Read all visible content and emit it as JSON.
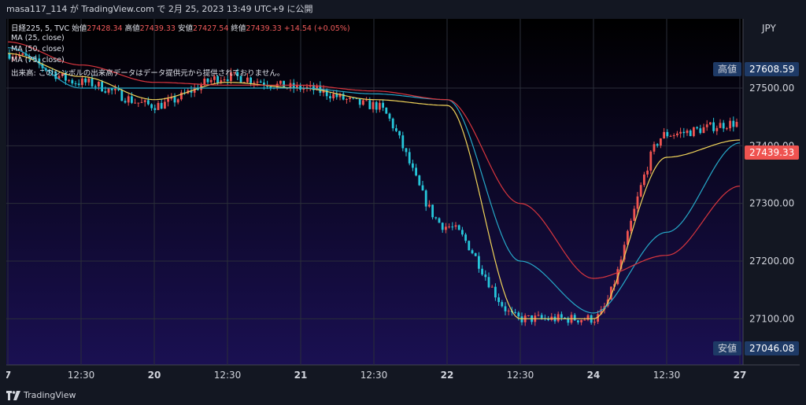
{
  "header": {
    "title": "masa117_114 が TradingView.com で 2月 25, 2023 13:49 UTC+9 に公開"
  },
  "legend": {
    "symbol": "日経225, 5, TVC",
    "open_label": "始値",
    "open_value": "27428.34",
    "high_label": "高値",
    "high_value": "27439.33",
    "low_label": "安値",
    "low_value": "27427.54",
    "close_label": "終値",
    "close_value": "27439.33",
    "change": "+14.54 (+0.05%)",
    "ma1": "MA (25, close)",
    "ma2": "MA (50, close)",
    "ma3": "MA (75, close)",
    "volume_note": "出来高: このシンボルの出来高データはデータ提供元から提供されておりません。"
  },
  "price_axis": {
    "currency": "JPY",
    "ticks": [
      "27500.00",
      "27400.00",
      "27300.00",
      "27200.00",
      "27100.00"
    ],
    "high_label": "高値",
    "high_value": "27608.59",
    "low_label": "安値",
    "low_value": "27046.08",
    "last_price": "27439.33"
  },
  "time_axis": {
    "ticks": [
      "7",
      "12:30",
      "20",
      "12:30",
      "21",
      "12:30",
      "22",
      "12:30",
      "24",
      "12:30",
      "27"
    ]
  },
  "footer": {
    "brand": "TradingView"
  },
  "colors": {
    "background_top": "#000000",
    "background_bottom": "#1a1052",
    "up": "#ef5350",
    "down": "#26c6da",
    "ma25": "#f0d35a",
    "ma50": "#26a8c8",
    "ma75": "#d9363e",
    "last_price_tag": "#ef5350",
    "high_low_tag": "#1e3a66"
  },
  "chart_data": {
    "type": "candlestick",
    "title": "日経225, 5, TVC",
    "ylim": [
      27020,
      27620
    ],
    "x": [
      "7",
      "12:30",
      "20",
      "12:30",
      "21",
      "12:30",
      "22",
      "12:30",
      "24",
      "12:30",
      "27"
    ],
    "session_close_approx": [
      27560,
      27510,
      27470,
      27520,
      27500,
      27470,
      27260,
      27100,
      27100,
      27420,
      27439.33
    ],
    "series": [
      {
        "name": "MA (25, close)",
        "approx_path": [
          27560,
          27520,
          27480,
          27510,
          27500,
          27480,
          27470,
          27100,
          27100,
          27380,
          27410
        ]
      },
      {
        "name": "MA (50, close)",
        "approx_path": [
          27570,
          27500,
          27500,
          27500,
          27500,
          27490,
          27480,
          27200,
          27110,
          27250,
          27405
        ]
      },
      {
        "name": "MA (75, close)",
        "approx_path": [
          27580,
          27540,
          27510,
          27505,
          27505,
          27495,
          27480,
          27300,
          27170,
          27210,
          27330
        ]
      }
    ]
  }
}
